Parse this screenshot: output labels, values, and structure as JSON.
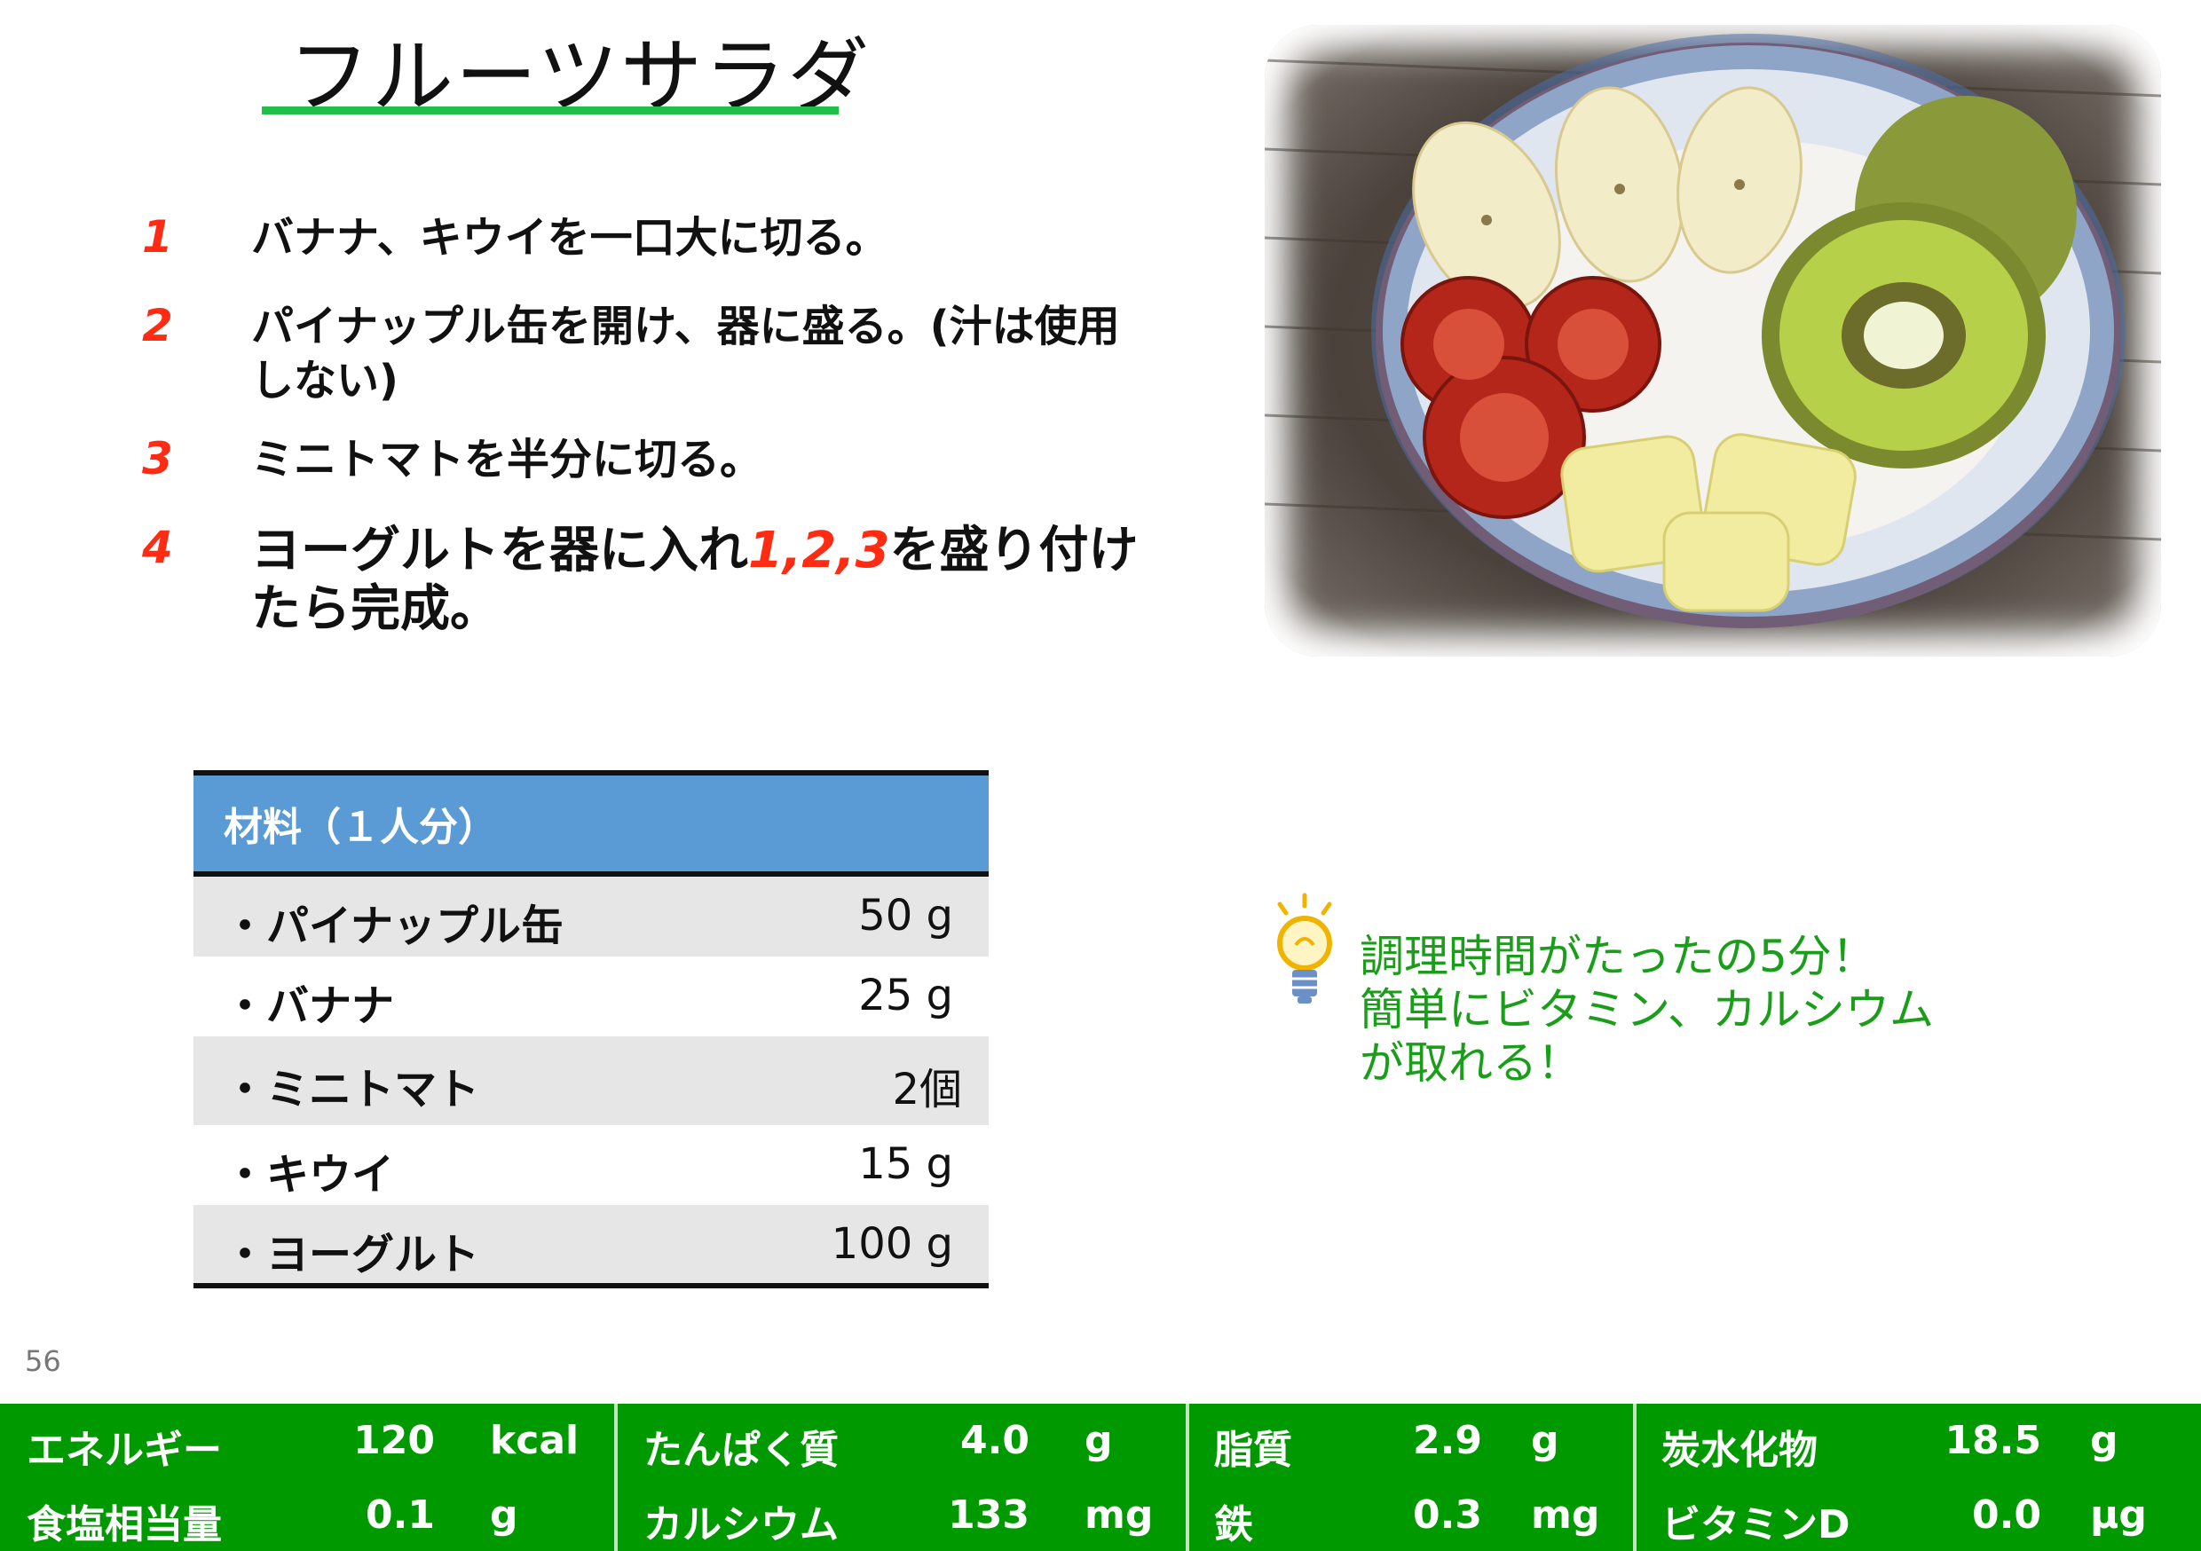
{
  "title": "フルーツサラダ",
  "steps": [
    {
      "num": "1",
      "text": "バナナ、キウイを一口大に切る。"
    },
    {
      "num": "2",
      "text": "パイナップル缶を開け、器に盛る。(汁は使用しない)"
    },
    {
      "num": "3",
      "text": "ミニトマトを半分に切る。"
    },
    {
      "num": "4",
      "text_before": "ヨーグルトを器に入れ",
      "refs": "1,2,3",
      "text_after": "を盛り付けたら完成。"
    }
  ],
  "ingredients": {
    "header": "材料（１人分）",
    "items": [
      {
        "name": "・パイナップル缶",
        "amount": "50 g"
      },
      {
        "name": "・バナナ",
        "amount": "25 g"
      },
      {
        "name": "・ミニトマト",
        "amount": "2個"
      },
      {
        "name": "・キウイ",
        "amount": "15 g"
      },
      {
        "name": "・ヨーグルト",
        "amount": "100 g"
      }
    ]
  },
  "tip": {
    "line1": "調理時間がたったの5分！",
    "line2": "簡単にビタミン、カルシウム",
    "line3": "が取れる！"
  },
  "page_number": "56",
  "nutrition": [
    {
      "label": "エネルギー",
      "value": "120",
      "unit": "kcal"
    },
    {
      "label": "たんぱく質",
      "value": "4.0",
      "unit": "g"
    },
    {
      "label": "脂質",
      "value": "2.9",
      "unit": "g"
    },
    {
      "label": "炭水化物",
      "value": "18.5",
      "unit": "g"
    },
    {
      "label": "食塩相当量",
      "value": "0.1",
      "unit": "g"
    },
    {
      "label": "カルシウム",
      "value": "133",
      "unit": "mg"
    },
    {
      "label": "鉄",
      "value": "0.3",
      "unit": "mg"
    },
    {
      "label": "ビタミンD",
      "value": "0.0",
      "unit": "μg"
    }
  ],
  "colors": {
    "accent_green": "#1fbf4a",
    "step_number_red": "#ff2b12",
    "table_header_blue": "#5b9bd5",
    "nutrition_bar_green": "#009a00",
    "tip_text_green": "#1a9e1a"
  },
  "icons": {
    "tip": "lightbulb-icon",
    "photo": "fruit-salad-photo"
  }
}
